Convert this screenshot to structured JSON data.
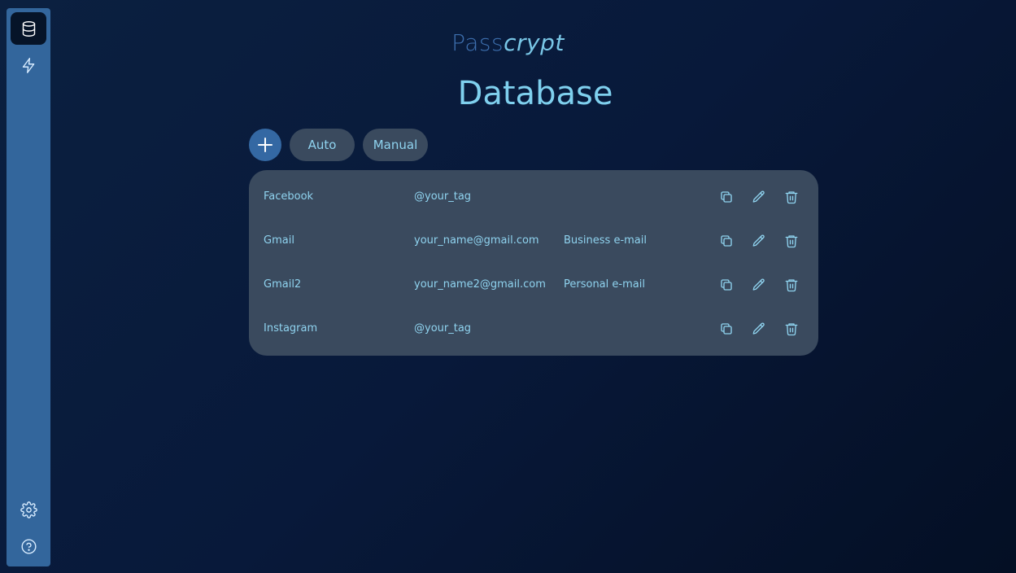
{
  "app": {
    "logo_pass": "Pass",
    "logo_crypt": "crypt",
    "page_title": "Database"
  },
  "sidebar": {
    "items": [
      {
        "icon": "database-icon",
        "active": true
      },
      {
        "icon": "lightning-icon",
        "active": false
      },
      {
        "icon": "gear-icon",
        "active": false
      },
      {
        "icon": "help-icon",
        "active": false
      }
    ]
  },
  "toolbar": {
    "add_icon": "plus-icon",
    "auto_label": "Auto",
    "manual_label": "Manual"
  },
  "entries": [
    {
      "name": "Facebook",
      "user": "@your_tag",
      "note": ""
    },
    {
      "name": "Gmail",
      "user": "your_name@gmail.com",
      "note": "Business e-mail"
    },
    {
      "name": "Gmail2",
      "user": "your_name2@gmail.com",
      "note": "Personal e-mail"
    },
    {
      "name": "Instagram",
      "user": "@your_tag",
      "note": ""
    }
  ],
  "colors": {
    "accent": "#33669c",
    "text": "#8fd3ef",
    "panel": "#3a4a5e",
    "background": "#061428"
  }
}
